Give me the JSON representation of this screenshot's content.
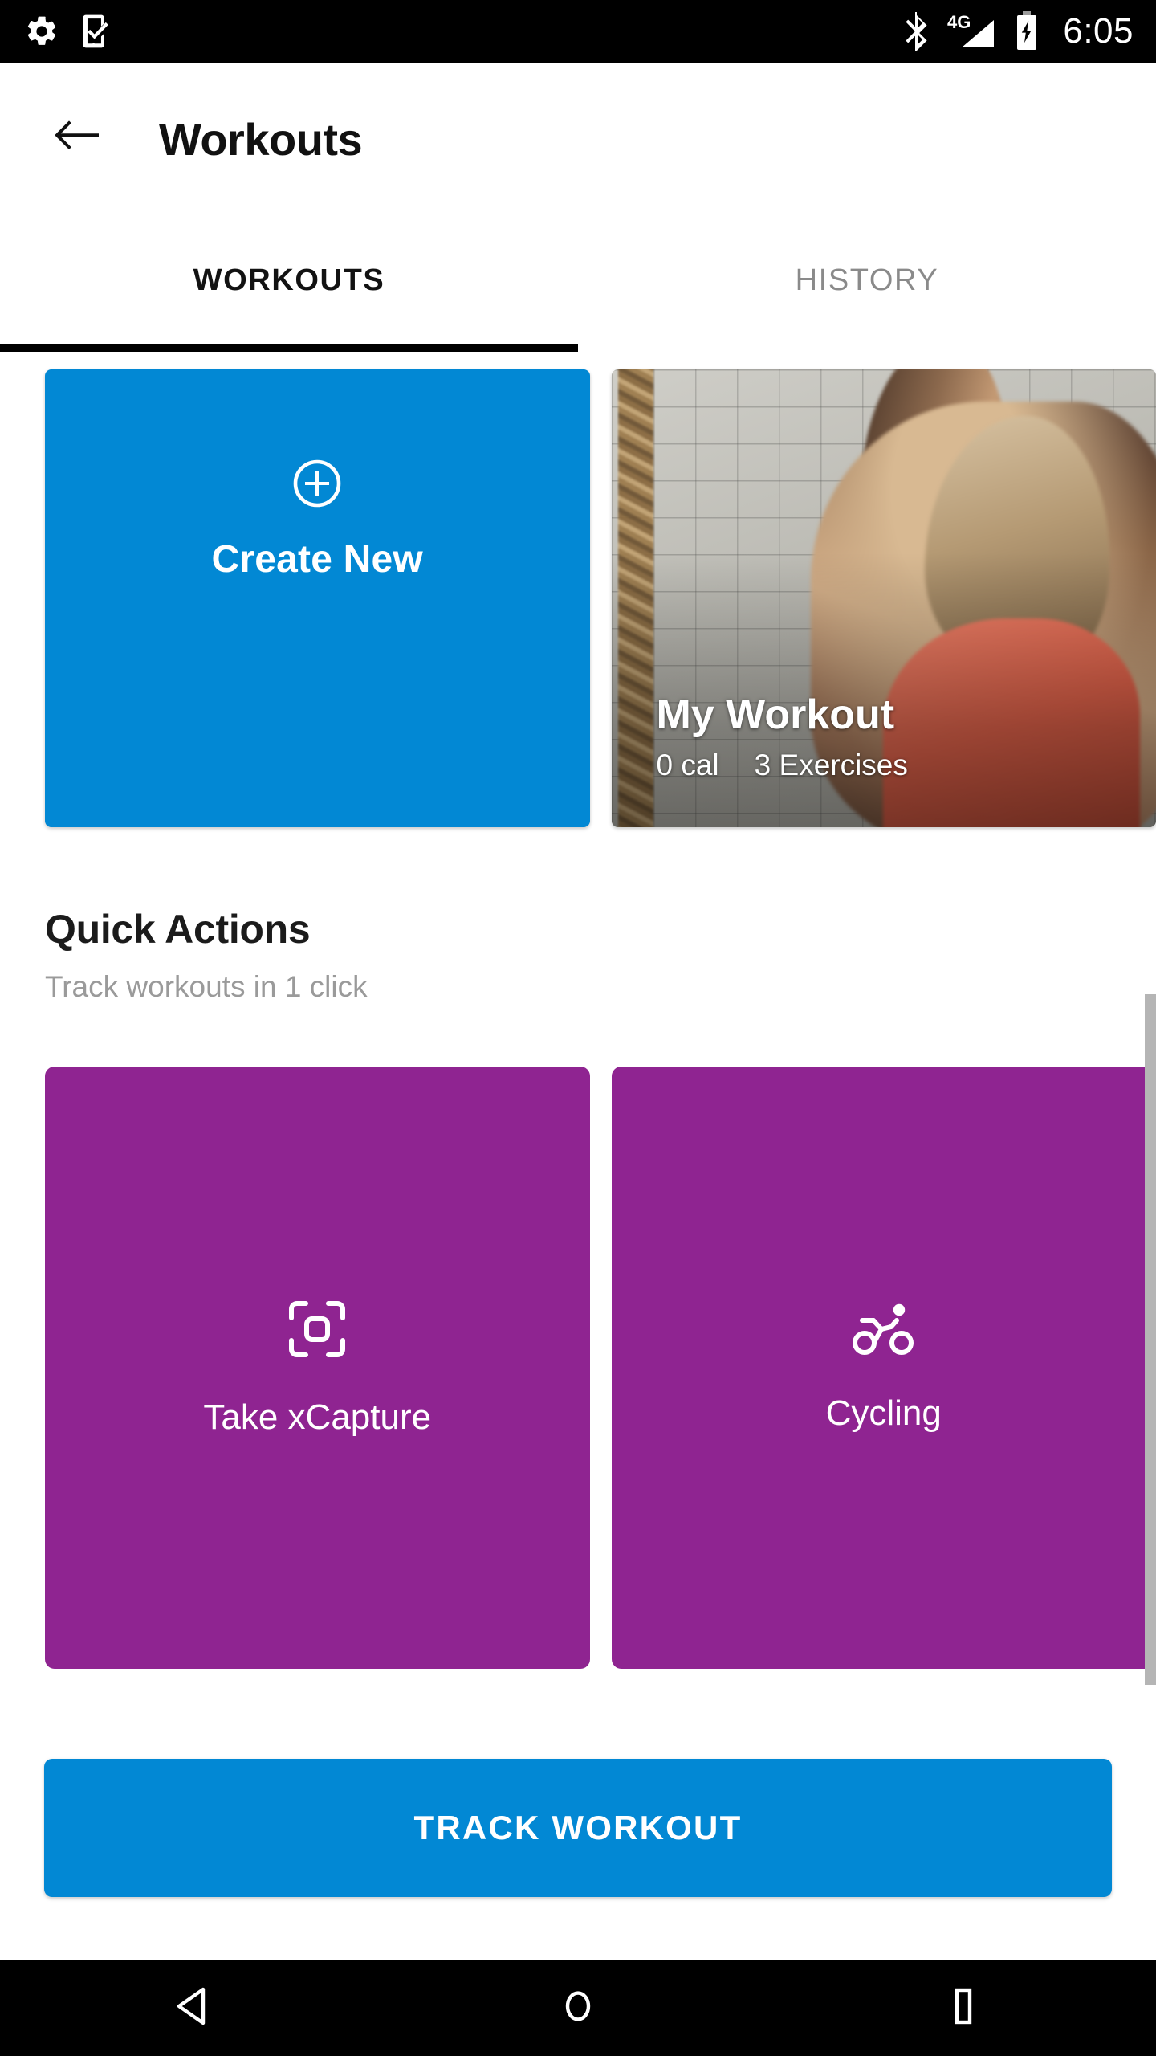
{
  "status_bar": {
    "left_icons": [
      "settings-gear-icon",
      "device-check-icon"
    ],
    "right_icons": [
      "bluetooth-icon",
      "signal-4g-icon",
      "battery-charging-icon"
    ],
    "network_label": "4G",
    "time": "6:05"
  },
  "app_bar": {
    "back_icon": "back-arrow-icon",
    "title": "Workouts"
  },
  "tabs": [
    {
      "label": "WORKOUTS",
      "active": true
    },
    {
      "label": "HISTORY",
      "active": false
    }
  ],
  "workouts": {
    "create_card": {
      "icon": "plus-circle-icon",
      "label": "Create New",
      "color": "#0288d4"
    },
    "items": [
      {
        "title": "My Workout",
        "calories": "0 cal",
        "exercises": "3 Exercises"
      }
    ]
  },
  "quick_actions": {
    "title": "Quick Actions",
    "subtitle": "Track workouts in 1 click",
    "card_color": "#8f2491",
    "items": [
      {
        "icon": "scan-capture-icon",
        "label": "Take xCapture"
      },
      {
        "icon": "cycling-icon",
        "label": "Cycling"
      }
    ]
  },
  "bottom_action": {
    "label": "TRACK WORKOUT",
    "color": "#0288d4"
  },
  "nav_bar": {
    "back": "nav-back-triangle-icon",
    "home": "nav-home-circle-icon",
    "recents": "nav-recents-square-icon"
  }
}
